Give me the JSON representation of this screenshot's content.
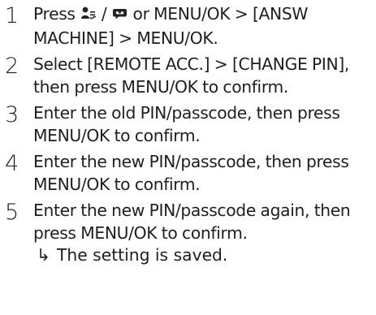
{
  "steps": [
    {
      "number": "1",
      "seg1": "Press ",
      "icon1": "answering-machine-icon",
      "sep1": " / ",
      "icon2": "message-bubble-icon",
      "seg2": " or MENU/OK > [ANSW MACHINE] > MENU/OK."
    },
    {
      "number": "2",
      "text": "Select [REMOTE ACC.] > [CHANGE PIN], then press MENU/OK to confirm."
    },
    {
      "number": "3",
      "text": "Enter the old PIN/passcode, then press MENU/OK to confirm."
    },
    {
      "number": "4",
      "text": "Enter the new PIN/passcode, then press MENU/OK to confirm."
    },
    {
      "number": "5",
      "text": "Enter the new PIN/passcode again, then press MENU/OK to confirm.",
      "result_arrow": "↳",
      "result_text": "The setting is saved."
    }
  ]
}
